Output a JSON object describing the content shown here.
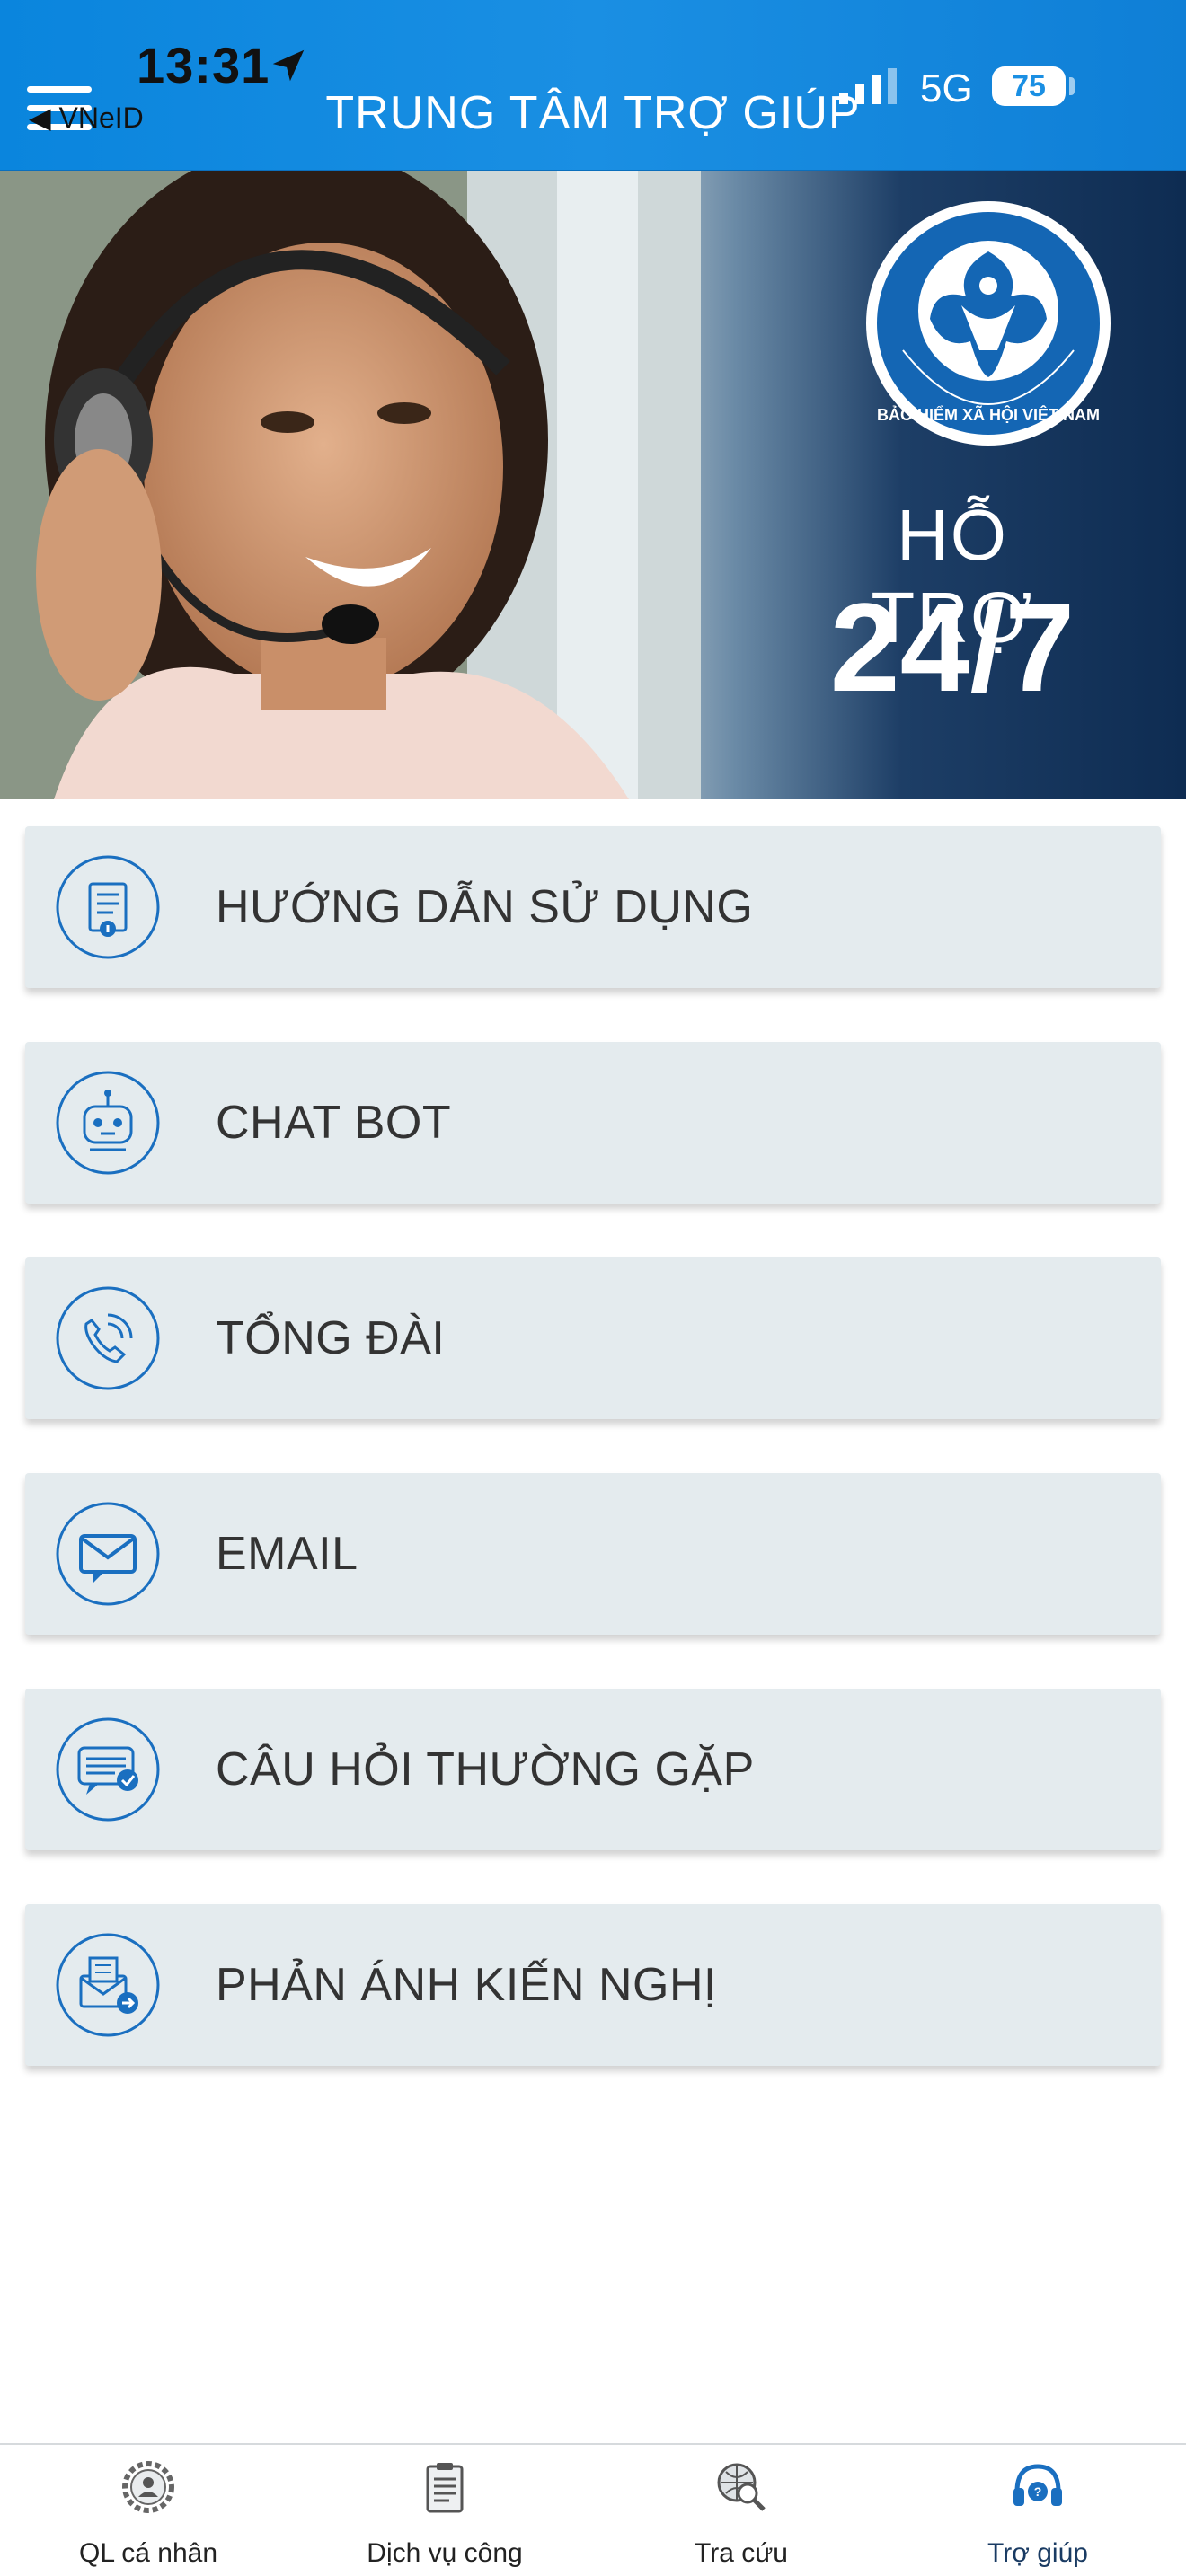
{
  "status_bar": {
    "time": "13:31",
    "network": "5G",
    "battery": "75",
    "back_label": "◀ VNeID"
  },
  "header": {
    "title": "TRUNG TÂM TRỢ GIÚP"
  },
  "banner": {
    "seal_text": "BẢO HIỂM XÃ HỘI VIỆT NAM",
    "subtitle": "HỖ TRỢ",
    "headline": "24/7"
  },
  "menu": {
    "items": [
      {
        "label": "HƯỚNG DẪN SỬ DỤNG",
        "icon": "guide-document-icon"
      },
      {
        "label": "CHAT BOT",
        "icon": "robot-icon"
      },
      {
        "label": "TỔNG ĐÀI",
        "icon": "phone-icon"
      },
      {
        "label": "EMAIL",
        "icon": "email-icon"
      },
      {
        "label": "CÂU HỎI THƯỜNG GẶP",
        "icon": "faq-chat-icon"
      },
      {
        "label": "PHẢN ÁNH KIẾN NGHỊ",
        "icon": "feedback-mail-icon"
      }
    ]
  },
  "tabbar": {
    "tabs": [
      {
        "label": "QL cá nhân",
        "icon": "user-gear-icon"
      },
      {
        "label": "Dịch vụ công",
        "icon": "clipboard-icon"
      },
      {
        "label": "Tra cứu",
        "icon": "globe-search-icon"
      },
      {
        "label": "Trợ giúp",
        "icon": "headset-help-icon",
        "active": true
      }
    ]
  },
  "colors": {
    "header_blue": "#1a8fe3",
    "icon_blue": "#1a6fc0",
    "card_bg": "#e4ebee"
  }
}
